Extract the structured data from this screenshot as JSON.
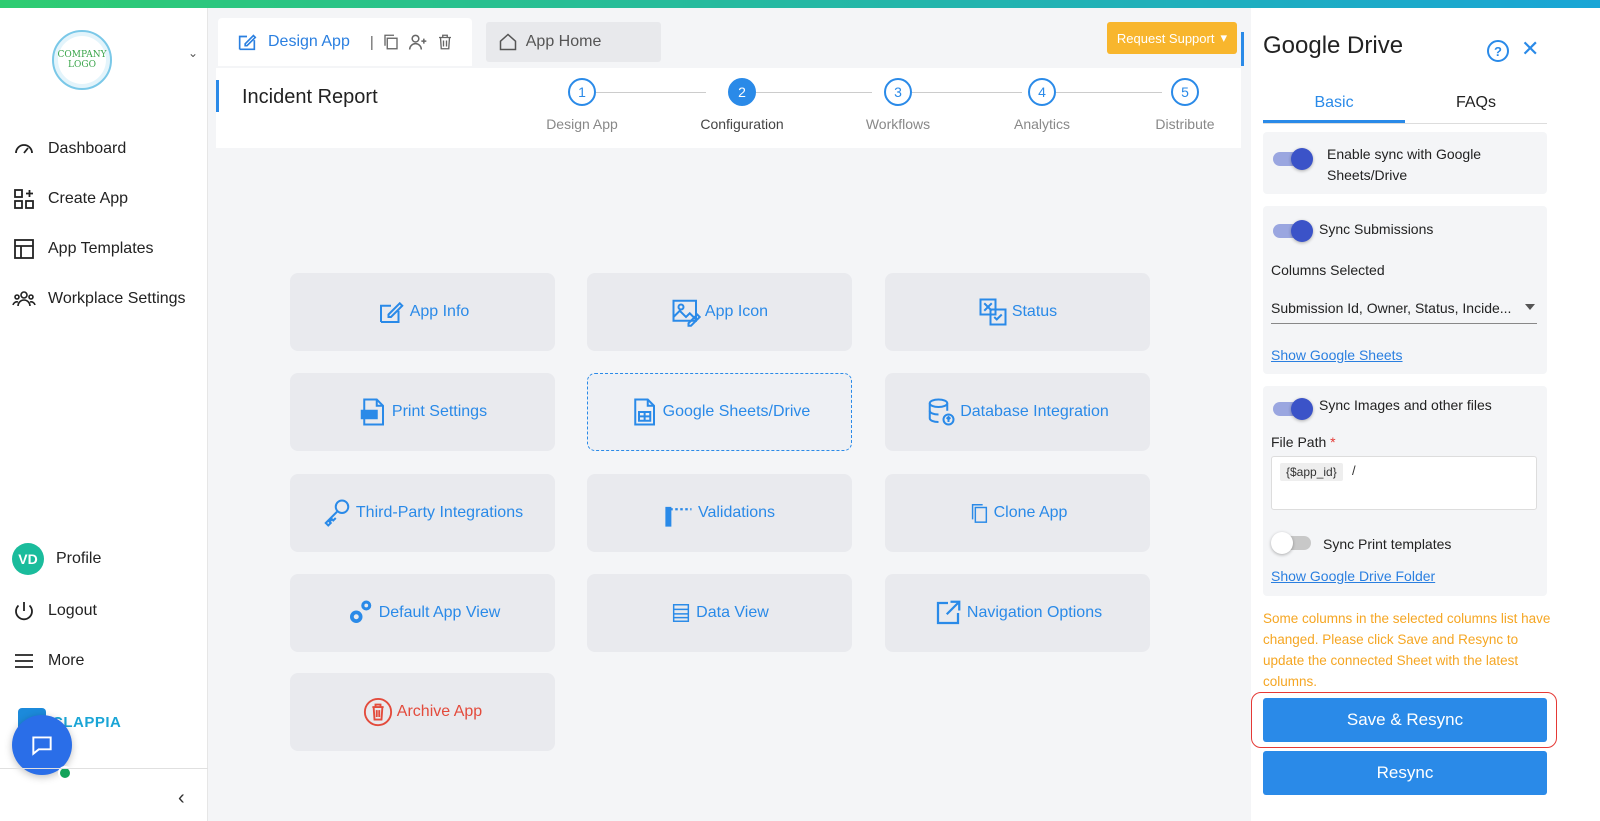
{
  "sidebar": {
    "logo_text": "COMPANY LOGO",
    "items": [
      {
        "label": "Dashboard",
        "icon": "dashboard-icon"
      },
      {
        "label": "Create App",
        "icon": "create-app-icon"
      },
      {
        "label": "App Templates",
        "icon": "templates-icon"
      },
      {
        "label": "Workplace Settings",
        "icon": "users-icon"
      }
    ],
    "profile": {
      "initials": "VD",
      "label": "Profile"
    },
    "logout_label": "Logout",
    "more_label": "More",
    "brand": "CLAPPIA"
  },
  "tabs": {
    "design_label": "Design App",
    "separator": "|",
    "home_label": "App Home"
  },
  "request_support_label": "Request Support",
  "page_title": "Incident Report",
  "steps": [
    {
      "num": "1",
      "label": "Design App"
    },
    {
      "num": "2",
      "label": "Configuration"
    },
    {
      "num": "3",
      "label": "Workflows"
    },
    {
      "num": "4",
      "label": "Analytics"
    },
    {
      "num": "5",
      "label": "Distribute"
    }
  ],
  "active_step": "2",
  "cards": [
    {
      "label": "App Info",
      "icon": "edit-icon"
    },
    {
      "label": "App Icon",
      "icon": "image-icon"
    },
    {
      "label": "Status",
      "icon": "status-icon"
    },
    {
      "label": "Print Settings",
      "icon": "pdf-icon"
    },
    {
      "label": "Google Sheets/Drive",
      "icon": "sheet-icon"
    },
    {
      "label": "Database Integration",
      "icon": "database-icon"
    },
    {
      "label": "Third-Party Integrations",
      "icon": "key-icon"
    },
    {
      "label": "Validations",
      "icon": "validation-icon"
    },
    {
      "label": "Clone App",
      "icon": "copy-icon"
    },
    {
      "label": "Default App View",
      "icon": "gears-icon"
    },
    {
      "label": "Data View",
      "icon": "list-icon"
    },
    {
      "label": "Navigation Options",
      "icon": "external-link-icon"
    },
    {
      "label": "Archive App",
      "icon": "trash-icon"
    }
  ],
  "panel": {
    "title": "Google Drive",
    "help": "?",
    "tabs": [
      "Basic",
      "FAQs"
    ],
    "enable_sync_label": "Enable sync with Google Sheets/Drive",
    "sync_submissions_label": "Sync Submissions",
    "columns_selected_label": "Columns Selected",
    "columns_value": "Submission Id, Owner, Status, Incide...",
    "show_sheets_link": "Show Google Sheets",
    "sync_images_label": "Sync Images and other files",
    "file_path_label": "File Path",
    "required_mark": "*",
    "file_path_chip": "{$app_id}",
    "file_path_suffix": "/",
    "sync_print_label": "Sync Print templates",
    "show_drive_link": "Show Google Drive Folder",
    "warning": "Some columns in the selected columns list have changed. Please click Save and Resync to update the connected Sheet with the latest columns.",
    "save_resync_label": "Save & Resync",
    "resync_label": "Resync"
  }
}
